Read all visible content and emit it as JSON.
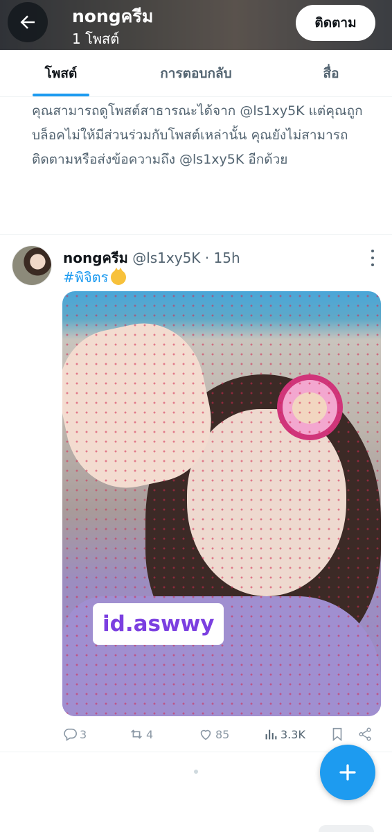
{
  "header": {
    "name": "nongครีม",
    "post_count": "1 โพสต์",
    "follow_label": "ติดตาม"
  },
  "tabs": [
    {
      "label": "โพสต์",
      "active": true
    },
    {
      "label": "การตอบกลับ",
      "active": false
    },
    {
      "label": "สื่อ",
      "active": false
    }
  ],
  "notice": {
    "text": "คุณสามารถดูโพสต์สาธารณะได้จาก @ls1xy5K แต่คุณถูกบล็อคไม่ให้มีส่วนร่วมกับโพสต์เหล่านั้น คุณยังไม่สามารถติดตามหรือส่งข้อความถึง @ls1xy5K อีกด้วย"
  },
  "post": {
    "display_name": "nongครีม",
    "handle": "@ls1xy5K",
    "dot": "·",
    "time": "15h",
    "text": "#พิจิตร",
    "emoji": "cat-emoji",
    "media_label": "id.aswwy",
    "stats": {
      "replies": "3",
      "retweets": "4",
      "likes": "85",
      "views": "3.3K"
    }
  },
  "colors": {
    "accent": "#1d9bf0",
    "text_primary": "#0f1419",
    "text_secondary": "#536471",
    "media_label": "#7b3fe0"
  },
  "icons": [
    "back-arrow-icon",
    "more-icon",
    "reply-icon",
    "retweet-icon",
    "like-icon",
    "views-icon",
    "bookmark-icon",
    "share-icon",
    "compose-icon"
  ]
}
